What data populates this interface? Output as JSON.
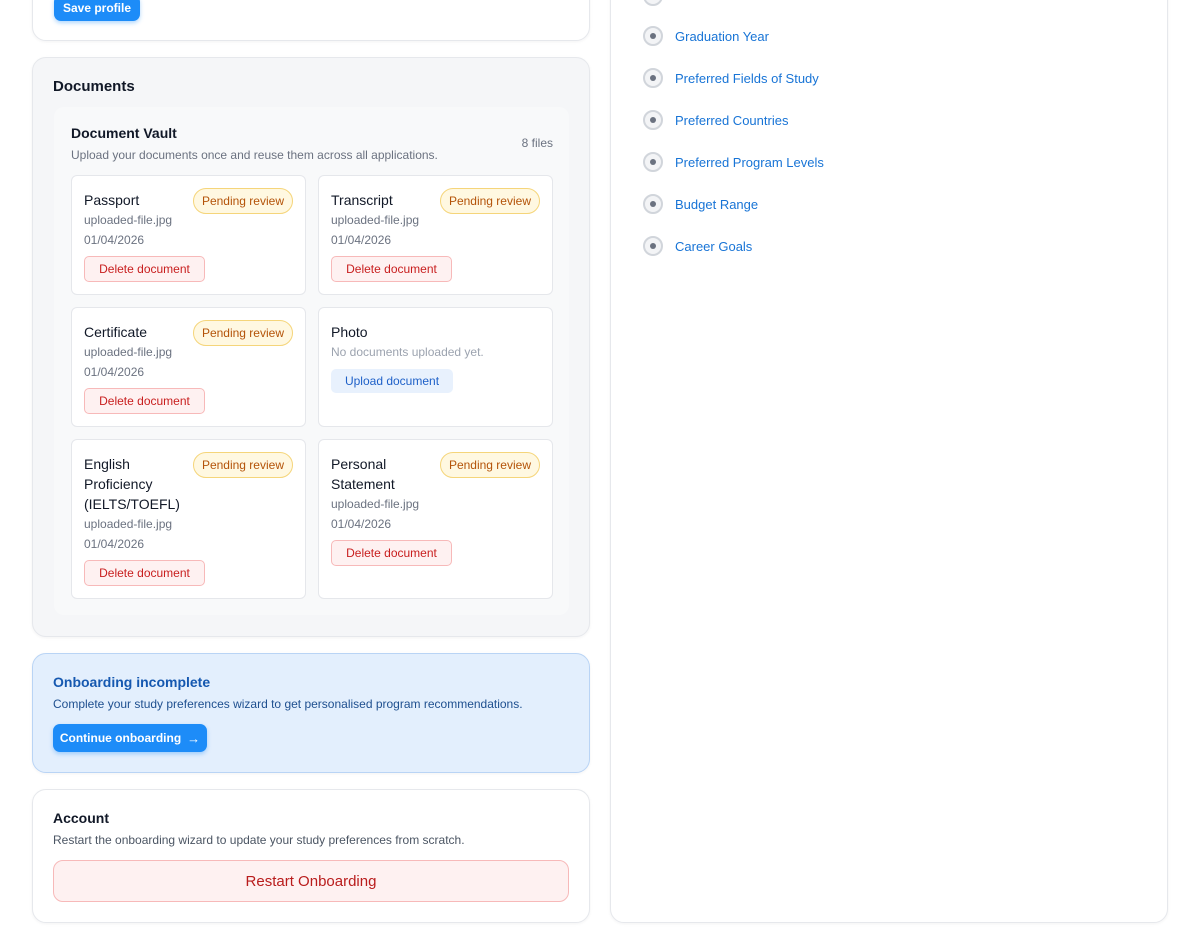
{
  "profile": {
    "save_label": "Save profile"
  },
  "documents": {
    "section_title": "Documents",
    "vault_title": "Document Vault",
    "vault_description": "Upload your documents once and reuse them across all applications.",
    "file_count": "8 files",
    "items": [
      {
        "name": "Passport",
        "status": "Pending review",
        "filename": "uploaded-file.jpg",
        "date": "01/04/2026",
        "action": "Delete document"
      },
      {
        "name": "Transcript",
        "status": "Pending review",
        "filename": "uploaded-file.jpg",
        "date": "01/04/2026",
        "action": "Delete document"
      },
      {
        "name": "Certificate",
        "status": "Pending review",
        "filename": "uploaded-file.jpg",
        "date": "01/04/2026",
        "action": "Delete document"
      },
      {
        "name": "Photo",
        "empty_note": "No documents uploaded yet.",
        "action": "Upload document"
      },
      {
        "name": "English Proficiency (IELTS/TOEFL)",
        "status": "Pending review",
        "filename": "uploaded-file.jpg",
        "date": "01/04/2026",
        "action": "Delete document"
      },
      {
        "name": "Personal Statement",
        "status": "Pending review",
        "filename": "uploaded-file.jpg",
        "date": "01/04/2026",
        "action": "Delete document"
      }
    ]
  },
  "onboarding": {
    "title": "Onboarding incomplete",
    "description": "Complete your study preferences wizard to get personalised program recommendations.",
    "button_label": "Continue onboarding",
    "button_icon": "arrow-right-icon"
  },
  "account": {
    "title": "Account",
    "description": "Restart the onboarding wizard to update your study preferences from scratch.",
    "restart_label": "Restart Onboarding"
  },
  "wizard_steps": [
    {
      "label": "Graduation Year"
    },
    {
      "label": "Preferred Fields of Study"
    },
    {
      "label": "Preferred Countries"
    },
    {
      "label": "Preferred Program Levels"
    },
    {
      "label": "Budget Range"
    },
    {
      "label": "Career Goals"
    }
  ],
  "colors": {
    "primary": "#1d8cf8",
    "link": "#1874d6",
    "danger": "#c81e1e",
    "warning": "#b45309",
    "info_bg": "#e3effd"
  }
}
